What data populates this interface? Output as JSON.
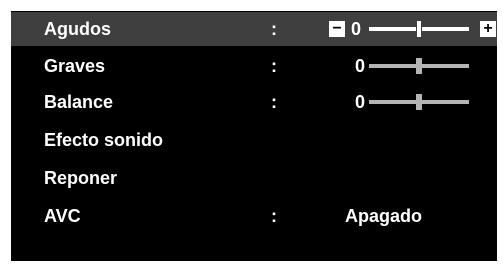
{
  "menu": {
    "rows": [
      {
        "label": "Agudos",
        "separator": ":",
        "value": "0",
        "level": 0.5,
        "minus_symbol": "−",
        "plus_symbol": "+",
        "selected": true
      },
      {
        "label": "Graves",
        "separator": ":",
        "value": "0",
        "level": 0.5
      },
      {
        "label": "Balance",
        "separator": ":",
        "value": "0",
        "level": 0.5
      },
      {
        "label": "Efecto sonido"
      },
      {
        "label": "Reponer"
      },
      {
        "label": "AVC",
        "separator": ":",
        "value": "Apagado"
      }
    ]
  },
  "colors": {
    "background": "#000000",
    "selected_row": "#3f3f3f",
    "text": "#ffffff",
    "slider_inactive": "#b4b4b4"
  }
}
